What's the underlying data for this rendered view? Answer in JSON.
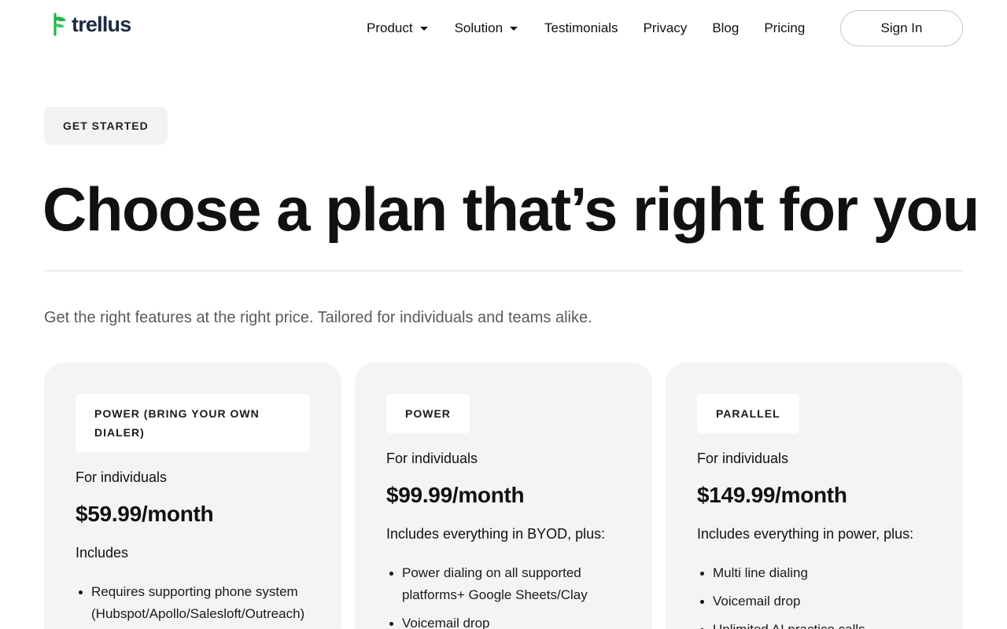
{
  "brand": {
    "name": "trellus",
    "accent": "#22b24c",
    "text_color": "#1f2a44"
  },
  "nav": {
    "items": [
      {
        "label": "Product",
        "dropdown": true
      },
      {
        "label": "Solution",
        "dropdown": true
      },
      {
        "label": "Testimonials",
        "dropdown": false
      },
      {
        "label": "Privacy",
        "dropdown": false
      },
      {
        "label": "Blog",
        "dropdown": false
      },
      {
        "label": "Pricing",
        "dropdown": false
      }
    ],
    "signin_label": "Sign In"
  },
  "hero": {
    "tag": "GET STARTED",
    "title": "Choose a plan that’s right for you",
    "subtitle": "Get the right features at the right price. Tailored for individuals and teams alike."
  },
  "plans": [
    {
      "badge": "POWER (BRING YOUR OWN DIALER)",
      "audience": "For individuals",
      "price": "$59.99/month",
      "includes": "Includes",
      "features": [
        "Requires supporting phone system (Hubspot/Apollo/Salesloft/Outreach)"
      ]
    },
    {
      "badge": "POWER",
      "audience": "For individuals",
      "price": "$99.99/month",
      "includes": "Includes everything in BYOD, plus:",
      "features": [
        "Power dialing on all supported platforms+ Google Sheets/Clay",
        "Voicemail drop"
      ]
    },
    {
      "badge": "PARALLEL",
      "audience": "For individuals",
      "price": "$149.99/month",
      "includes": "Includes everything in power, plus:",
      "features": [
        "Multi line dialing",
        "Voicemail drop",
        "Unlimited AI practice calls"
      ]
    }
  ],
  "icons": {
    "logo": "trellus-leaf-icon",
    "dropdown": "caret-down-icon"
  }
}
